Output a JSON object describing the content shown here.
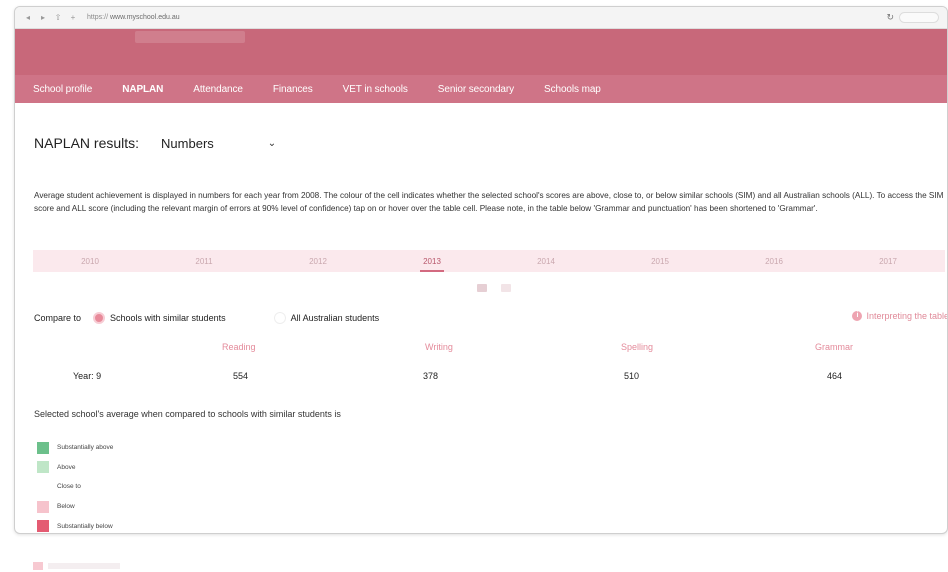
{
  "browser": {
    "url_prefix": "https://",
    "url_host": "www.myschool.edu.au"
  },
  "nav": {
    "tabs": [
      {
        "label": "School profile"
      },
      {
        "label": "NAPLAN"
      },
      {
        "label": "Attendance"
      },
      {
        "label": "Finances"
      },
      {
        "label": "VET in schools"
      },
      {
        "label": "Senior secondary"
      },
      {
        "label": "Schools map"
      }
    ],
    "active_index": 1
  },
  "naplan": {
    "heading": "NAPLAN results:",
    "view_selected": "Numbers",
    "description": "Average student achievement is displayed in numbers for each year from 2008. The colour of the cell indicates whether the selected school's scores are above, close to, or below similar schools (SIM) and all Australian schools (ALL). To access the SIM score and ALL score (including the relevant margin of errors at 90% level of confidence) tap on or hover over the table cell. Please note, in the table below 'Grammar and punctuation' has been shortened to 'Grammar'.",
    "years": [
      "2010",
      "2011",
      "2012",
      "2013",
      "2014",
      "2015",
      "2016",
      "2017"
    ],
    "selected_year": "2013"
  },
  "compare": {
    "label": "Compare to",
    "option_similar": "Schools with similar students",
    "option_all": "All Australian students",
    "selected": "similar",
    "interpreting_link": "Interpreting the table"
  },
  "results": {
    "columns": [
      "Reading",
      "Writing",
      "Spelling",
      "Grammar"
    ],
    "row_label": "Year: 9",
    "values": [
      "554",
      "378",
      "510",
      "464"
    ]
  },
  "avg_note": "Selected school's average when compared to schools with similar students is",
  "legend": [
    {
      "label": "Substantially above",
      "color": "#6cc08b"
    },
    {
      "label": "Above",
      "color": "#bfe6c7"
    },
    {
      "label": "Close to",
      "color": "#ffffff"
    },
    {
      "label": "Below",
      "color": "#f6c3cc"
    },
    {
      "label": "Substantially below",
      "color": "#e45b72"
    }
  ],
  "colors": {
    "header": "#c8687a",
    "nav": "#cf7487",
    "accent": "#e48b9b"
  }
}
